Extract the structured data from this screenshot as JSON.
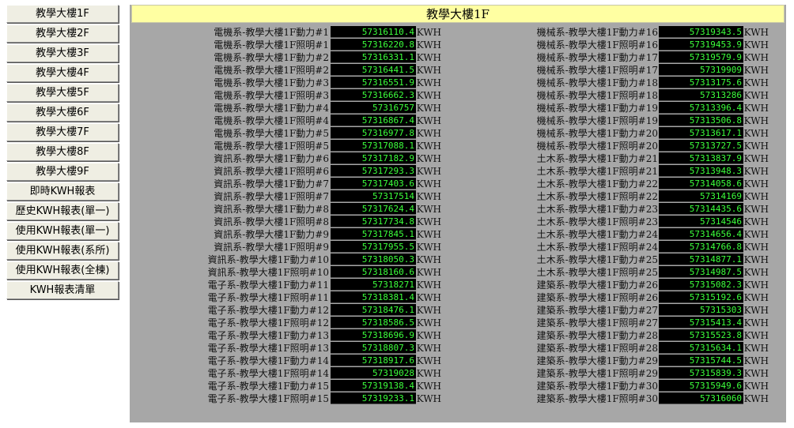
{
  "sidebar": {
    "items": [
      {
        "label": "教學大樓1F"
      },
      {
        "label": "教學大樓2F"
      },
      {
        "label": "教學大樓3F"
      },
      {
        "label": "教學大樓4F"
      },
      {
        "label": "教學大樓5F"
      },
      {
        "label": "教學大樓6F"
      },
      {
        "label": "教學大樓7F"
      },
      {
        "label": "教學大樓8F"
      },
      {
        "label": "教學大樓9F"
      },
      {
        "label": "即時KWH報表"
      },
      {
        "label": "歷史KWH報表(單一)"
      },
      {
        "label": "使用KWH報表(單一)"
      },
      {
        "label": "使用KWH報表(系所)"
      },
      {
        "label": "使用KWH報表(全棟)"
      },
      {
        "label": "KWH報表清單"
      }
    ]
  },
  "main": {
    "title": "教學大樓1F",
    "unit": "KWH",
    "left_rows": [
      {
        "label": "電機系-教學大樓1F動力#1",
        "value": "57316110.4"
      },
      {
        "label": "電機系-教學大樓1F照明#1",
        "value": "57316220.8"
      },
      {
        "label": "電機系-教學大樓1F動力#2",
        "value": "57316331.1"
      },
      {
        "label": "電機系-教學大樓1F照明#2",
        "value": "57316441.5"
      },
      {
        "label": "電機系-教學大樓1F動力#3",
        "value": "57316551.9"
      },
      {
        "label": "電機系-教學大樓1F照明#3",
        "value": "57316662.3"
      },
      {
        "label": "電機系-教學大樓1F動力#4",
        "value": "57316757"
      },
      {
        "label": "電機系-教學大樓1F照明#4",
        "value": "57316867.4"
      },
      {
        "label": "電機系-教學大樓1F動力#5",
        "value": "57316977.8"
      },
      {
        "label": "電機系-教學大樓1F照明#5",
        "value": "57317088.1"
      },
      {
        "label": "資訊系-教學大樓1F動力#6",
        "value": "57317182.9"
      },
      {
        "label": "資訊系-教學大樓1F照明#6",
        "value": "57317293.3"
      },
      {
        "label": "資訊系-教學大樓1F動力#7",
        "value": "57317403.6"
      },
      {
        "label": "資訊系-教學大樓1F照明#7",
        "value": "57317514"
      },
      {
        "label": "資訊系-教學大樓1F動力#8",
        "value": "57317624.4"
      },
      {
        "label": "資訊系-教學大樓1F照明#8",
        "value": "57317734.8"
      },
      {
        "label": "資訊系-教學大樓1F動力#9",
        "value": "57317845.1"
      },
      {
        "label": "資訊系-教學大樓1F照明#9",
        "value": "57317955.5"
      },
      {
        "label": "資訊系-教學大樓1F動力#10",
        "value": "57318050.3"
      },
      {
        "label": "資訊系-教學大樓1F照明#10",
        "value": "57318160.6"
      },
      {
        "label": "電子系-教學大樓1F動力#11",
        "value": "57318271"
      },
      {
        "label": "電子系-教學大樓1F照明#11",
        "value": "57318381.4"
      },
      {
        "label": "電子系-教學大樓1F動力#12",
        "value": "57318476.1"
      },
      {
        "label": "電子系-教學大樓1F照明#12",
        "value": "57318586.5"
      },
      {
        "label": "電子系-教學大樓1F動力#13",
        "value": "57318696.9"
      },
      {
        "label": "電子系-教學大樓1F照明#13",
        "value": "57318807.3"
      },
      {
        "label": "電子系-教學大樓1F動力#14",
        "value": "57318917.6"
      },
      {
        "label": "電子系-教學大樓1F照明#14",
        "value": "57319028"
      },
      {
        "label": "電子系-教學大樓1F動力#15",
        "value": "57319138.4"
      },
      {
        "label": "電子系-教學大樓1F照明#15",
        "value": "57319233.1"
      }
    ],
    "right_rows": [
      {
        "label": "機械系-教學大樓1F動力#16",
        "value": "57319343.5"
      },
      {
        "label": "機械系-教學大樓1F照明#16",
        "value": "57319453.9"
      },
      {
        "label": "機械系-教學大樓1F動力#17",
        "value": "57319579.9"
      },
      {
        "label": "機械系-教學大樓1F照明#17",
        "value": "57319909"
      },
      {
        "label": "機械系-教學大樓1F動力#18",
        "value": "57313175.6"
      },
      {
        "label": "機械系-教學大樓1F照明#18",
        "value": "57313286"
      },
      {
        "label": "機械系-教學大樓1F動力#19",
        "value": "57313396.4"
      },
      {
        "label": "機械系-教學大樓1F照明#19",
        "value": "57313506.8"
      },
      {
        "label": "機械系-教學大樓1F動力#20",
        "value": "57313617.1"
      },
      {
        "label": "機械系-教學大樓1F照明#20",
        "value": "57313727.5"
      },
      {
        "label": "土木系-教學大樓1F動力#21",
        "value": "57313837.9"
      },
      {
        "label": "土木系-教學大樓1F照明#21",
        "value": "57313948.3"
      },
      {
        "label": "土木系-教學大樓1F動力#22",
        "value": "57314058.6"
      },
      {
        "label": "土木系-教學大樓1F照明#22",
        "value": "57314169"
      },
      {
        "label": "土木系-教學大樓1F動力#23",
        "value": "57314435.6"
      },
      {
        "label": "土木系-教學大樓1F照明#23",
        "value": "57314546"
      },
      {
        "label": "土木系-教學大樓1F動力#24",
        "value": "57314656.4"
      },
      {
        "label": "土木系-教學大樓1F照明#24",
        "value": "57314766.8"
      },
      {
        "label": "土木系-教學大樓1F動力#25",
        "value": "57314877.1"
      },
      {
        "label": "土木系-教學大樓1F照明#25",
        "value": "57314987.5"
      },
      {
        "label": "建築系-教學大樓1F動力#26",
        "value": "57315082.3"
      },
      {
        "label": "建築系-教學大樓1F照明#26",
        "value": "57315192.6"
      },
      {
        "label": "建築系-教學大樓1F動力#27",
        "value": "57315303"
      },
      {
        "label": "建築系-教學大樓1F照明#27",
        "value": "57315413.4"
      },
      {
        "label": "建築系-教學大樓1F動力#28",
        "value": "57315523.8"
      },
      {
        "label": "建築系-教學大樓1F照明#28",
        "value": "57315634.1"
      },
      {
        "label": "建築系-教學大樓1F動力#29",
        "value": "57315744.5"
      },
      {
        "label": "建築系-教學大樓1F照明#29",
        "value": "57315839.3"
      },
      {
        "label": "建築系-教學大樓1F動力#30",
        "value": "57315949.6"
      },
      {
        "label": "建築系-教學大樓1F照明#30",
        "value": "57316060"
      }
    ]
  }
}
